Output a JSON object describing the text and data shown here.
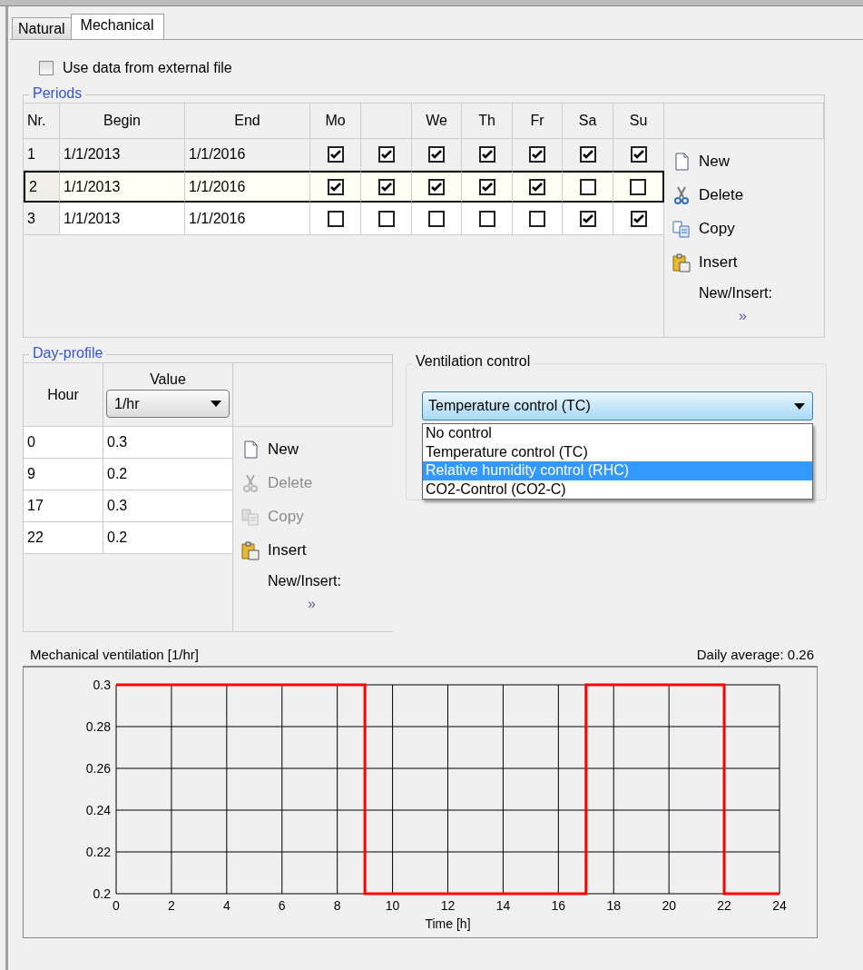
{
  "tabs": [
    {
      "label": "Natural",
      "selected": false
    },
    {
      "label": "Mechanical",
      "selected": true
    }
  ],
  "external_file": {
    "label": "Use data from external file",
    "checked": false
  },
  "periods": {
    "title": "Periods",
    "columns": [
      "Nr.",
      "Begin",
      "End"
    ],
    "day_columns": [
      "Mo",
      null,
      "We",
      "Th",
      "Fr",
      "Sa",
      "Su"
    ],
    "rows": [
      {
        "nr": "1",
        "begin": "1/1/2013",
        "end": "1/1/2016",
        "days": [
          true,
          true,
          true,
          true,
          true,
          true,
          true
        ],
        "selected": false
      },
      {
        "nr": "2",
        "begin": "1/1/2013",
        "end": "1/1/2016",
        "days": [
          true,
          true,
          true,
          true,
          true,
          false,
          false
        ],
        "selected": true
      },
      {
        "nr": "3",
        "begin": "1/1/2013",
        "end": "1/1/2016",
        "days": [
          false,
          false,
          false,
          false,
          false,
          true,
          true
        ],
        "selected": false
      }
    ],
    "actions": [
      {
        "kind": "new",
        "label": "New",
        "disabled": false
      },
      {
        "kind": "delete",
        "label": "Delete",
        "disabled": false
      },
      {
        "kind": "copy",
        "label": "Copy",
        "disabled": false
      },
      {
        "kind": "insert",
        "label": "Insert",
        "disabled": false
      }
    ],
    "new_insert_label": "New/Insert:",
    "more": "»"
  },
  "day_profile": {
    "title": "Day-profile",
    "columns": [
      "Hour",
      "Value"
    ],
    "unit": "1/hr",
    "rows": [
      {
        "hour": "0",
        "value": "0.3"
      },
      {
        "hour": "9",
        "value": "0.2"
      },
      {
        "hour": "17",
        "value": "0.3"
      },
      {
        "hour": "22",
        "value": "0.2"
      }
    ],
    "actions": [
      {
        "kind": "new",
        "label": "New",
        "disabled": false
      },
      {
        "kind": "delete",
        "label": "Delete",
        "disabled": true
      },
      {
        "kind": "copy",
        "label": "Copy",
        "disabled": true
      },
      {
        "kind": "insert",
        "label": "Insert",
        "disabled": false
      }
    ],
    "new_insert_label": "New/Insert:",
    "more": "»"
  },
  "ventilation_control": {
    "title": "Ventilation control",
    "value": "Temperature control (TC)",
    "expanded": true,
    "options": [
      {
        "label": "No control",
        "highlighted": false
      },
      {
        "label": "Temperature control (TC)",
        "highlighted": false
      },
      {
        "label": "Relative humidity control (RHC)",
        "highlighted": true
      },
      {
        "label": "CO2-Control (CO2-C)",
        "highlighted": false
      }
    ]
  },
  "chart": {
    "daily_average": "Daily average: 0.26",
    "chart_data": {
      "type": "line",
      "title": "Mechanical ventilation [1/hr]",
      "xlabel": "Time [h]",
      "x": [
        0,
        9,
        9,
        17,
        17,
        22,
        22,
        24
      ],
      "grid": true,
      "series": [
        {
          "color": "#ff0000",
          "values": [
            0.3,
            0.3,
            0.2,
            0.2,
            0.3,
            0.3,
            0.2,
            0.2
          ]
        }
      ],
      "xlim": [
        0,
        24
      ],
      "ylim": [
        0.2,
        0.3
      ],
      "xticks": [
        0,
        2,
        4,
        6,
        8,
        10,
        12,
        14,
        16,
        18,
        20,
        22,
        24
      ],
      "yticks": [
        0.2,
        0.22,
        0.24,
        0.26,
        0.28,
        0.3
      ]
    }
  }
}
